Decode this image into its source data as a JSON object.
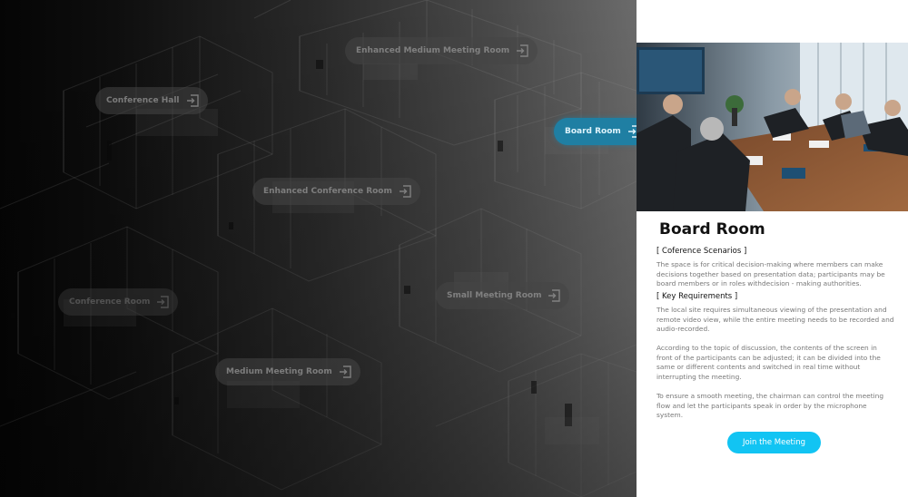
{
  "rooms": [
    {
      "id": "conference-hall",
      "label": "Conference Hall"
    },
    {
      "id": "enhanced-medium-meeting-room",
      "label": "Enhanced Medium Meeting Room"
    },
    {
      "id": "board-room",
      "label": "Board Room"
    },
    {
      "id": "enhanced-conference-room",
      "label": "Enhanced Conference Room"
    },
    {
      "id": "conference-room",
      "label": "Conference Room"
    },
    {
      "id": "small-meeting-room",
      "label": "Small Meeting Room"
    },
    {
      "id": "medium-meeting-room",
      "label": "Medium Meeting Room"
    }
  ],
  "selected_room": "Board Room",
  "panel": {
    "title": "Board Room",
    "scenarios_head": "[ Coference Scenarios ]",
    "scenarios_text": "The space is for critical decision-making where members can make decisions together based on presentation data; participants may be board members or in roles withdecision - making authorities.",
    "requirements_head": "[ Key Requirements ]",
    "requirements_p1": "The local site requires simultaneous viewing of the presentation and remote video view, while the entire meeting needs to be recorded and audio-recorded.",
    "requirements_p2": "According to the topic of discussion, the contents of the screen in front of the participants can be adjusted; it can be divided into the same or different contents and switched in real time without interrupting the meeting.",
    "requirements_p3": "To ensure a smooth meeting, the chairman can control the meeting flow and let the participants speak in order by the microphone system.",
    "join_label": "Join the Meeting"
  },
  "colors": {
    "accent": "#12c4f3",
    "active_room": "#1f7fa3"
  },
  "icons": {
    "room_button": "enter-door-icon"
  }
}
